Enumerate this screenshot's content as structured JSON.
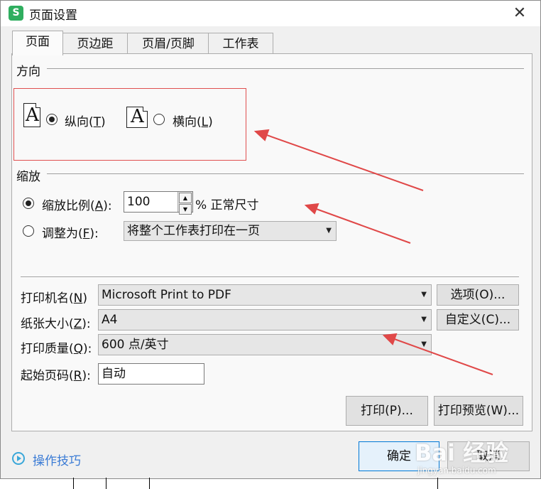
{
  "window": {
    "title": "页面设置",
    "app_icon": "S",
    "close": "✕"
  },
  "tabs": [
    "页面",
    "页边距",
    "页眉/页脚",
    "工作表"
  ],
  "orientation": {
    "section": "方向",
    "portrait": {
      "label": "纵向(",
      "key": "T",
      "close": ")",
      "selected": true
    },
    "landscape": {
      "label": "横向(",
      "key": "L",
      "close": ")",
      "selected": false
    },
    "icon_glyph": "A"
  },
  "scaling": {
    "section": "缩放",
    "ratio": {
      "label": "缩放比例(",
      "key": "A",
      "close": "):",
      "value": "100",
      "suffix": "% 正常尺寸",
      "selected": true
    },
    "fit": {
      "label": "调整为(",
      "key": "F",
      "close": "):",
      "value": "将整个工作表打印在一页",
      "selected": false
    }
  },
  "printer": {
    "name": {
      "label": "打印机名(",
      "key": "N",
      "close": ")",
      "value": "Microsoft Print to PDF",
      "button": "选项(O)..."
    },
    "paper": {
      "label": "纸张大小(",
      "key": "Z",
      "close": "):",
      "value": "A4",
      "button": "自定义(C)..."
    },
    "quality": {
      "label": "打印质量(",
      "key": "Q",
      "close": "):",
      "value": "600 点/英寸"
    },
    "start_page": {
      "label": "起始页码(",
      "key": "R",
      "close": "):",
      "value": "自动"
    }
  },
  "actions": {
    "print": "打印(P)...",
    "preview": "打印预览(W)...",
    "ok": "确定",
    "cancel": "取消"
  },
  "footer": {
    "tips": "操作技巧"
  },
  "watermark": {
    "text": "Bai 经验",
    "sub": "jingyan.baidu.com"
  },
  "colors": {
    "accent_box": "#e05050",
    "arrow": "#e04848",
    "link": "#3a7bd5",
    "app_icon": "#2fae5f"
  }
}
